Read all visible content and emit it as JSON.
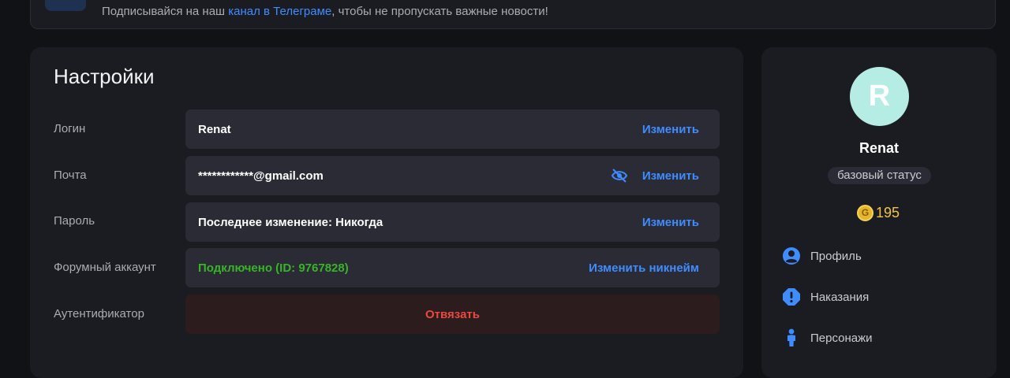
{
  "banner": {
    "text_before": "Подписывайся на наш ",
    "link_text": "канал в Телеграме",
    "text_after": ", чтобы не пропускать важные новости!"
  },
  "settings": {
    "title": "Настройки",
    "login": {
      "label": "Логин",
      "value": "Renat",
      "action": "Изменить"
    },
    "email": {
      "label": "Почта",
      "value": "************@gmail.com",
      "action": "Изменить",
      "icon": "eye-off-icon"
    },
    "password": {
      "label": "Пароль",
      "value": "Последнее изменение: Никогда",
      "action": "Изменить"
    },
    "forum": {
      "label": "Форумный аккаунт",
      "value": "Подключено (ID: 9767828)",
      "action": "Изменить никнейм"
    },
    "authenticator": {
      "label": "Аутентификатор",
      "action": "Отвязать"
    }
  },
  "profile": {
    "avatar_letter": "R",
    "name": "Renat",
    "status": "базовый статус",
    "coin_symbol": "G",
    "coins": "195",
    "nav": [
      {
        "label": "Профиль",
        "icon": "user-icon"
      },
      {
        "label": "Наказания",
        "icon": "warning-icon"
      },
      {
        "label": "Персонажи",
        "icon": "person-icon"
      }
    ]
  },
  "colors": {
    "background": "#111216",
    "card": "#1b1c21",
    "field": "#2a2b34",
    "accent": "#3f8cff",
    "success": "#38b427",
    "danger": "#e84a3f",
    "danger_bg": "#2c1c1e",
    "avatar": "#b5ece4",
    "coin": "#e6b62a"
  }
}
